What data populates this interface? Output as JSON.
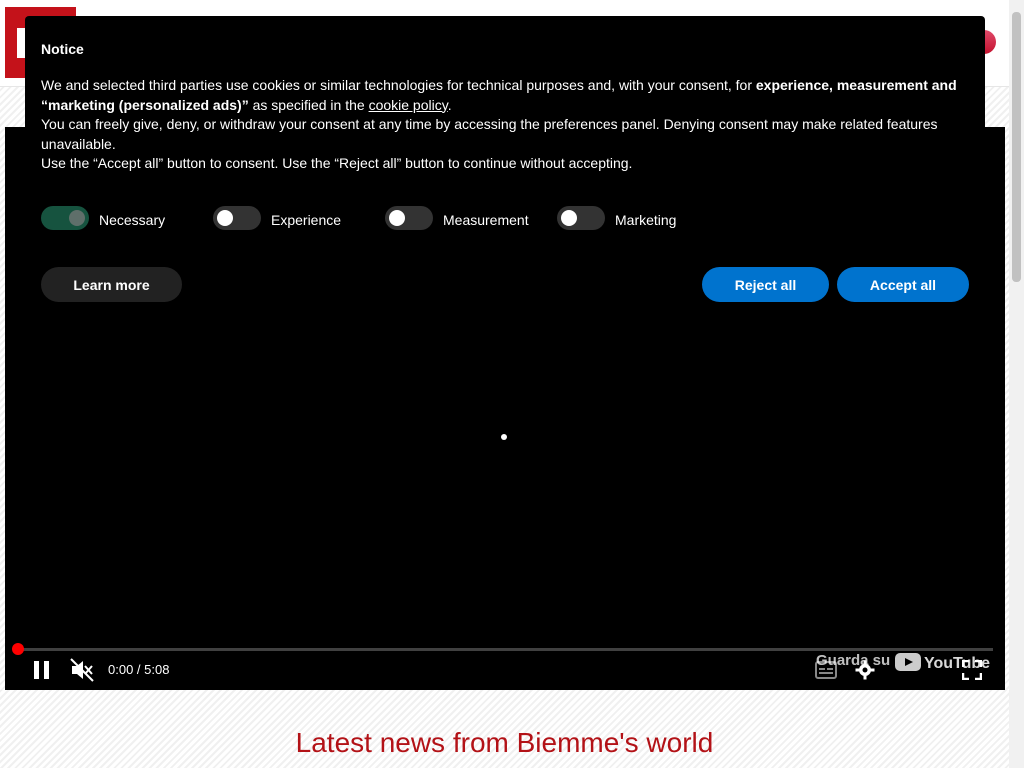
{
  "cookie_notice": {
    "title": "Notice",
    "paragraph1_pre": "We and selected third parties use cookies or similar technologies for technical purposes and, with your consent, for ",
    "paragraph1_bold": "experience, measurement and “marketing (personalized ads)”",
    "paragraph1_mid": " as specified in the ",
    "cookie_policy_link": "cookie policy",
    "paragraph1_end": ".",
    "paragraph2": "You can freely give, deny, or withdraw your consent at any time by accessing the preferences panel. Denying consent may make related features unavailable.",
    "paragraph3": "Use the “Accept all” button to consent. Use the “Reject all” button to continue without accepting.",
    "toggles": [
      {
        "label": "Necessary",
        "checked": true
      },
      {
        "label": "Experience",
        "checked": false
      },
      {
        "label": "Measurement",
        "checked": false
      },
      {
        "label": "Marketing",
        "checked": false
      }
    ],
    "learn_more_label": "Learn more",
    "reject_all_label": "Reject all",
    "accept_all_label": "Accept all",
    "button_color": "#0073ce",
    "toggle_on_color": "#16533f"
  },
  "video_player": {
    "time_display": "0:00 / 5:08",
    "progress": 0,
    "watch_on_label": "Guarda su",
    "platform_label": "YouTube",
    "progress_color": "#ff0000"
  },
  "header": {
    "brand_color": "#c4121a"
  },
  "news_section": {
    "heading": "Latest news from Biemme's world",
    "heading_color": "#b31217"
  }
}
